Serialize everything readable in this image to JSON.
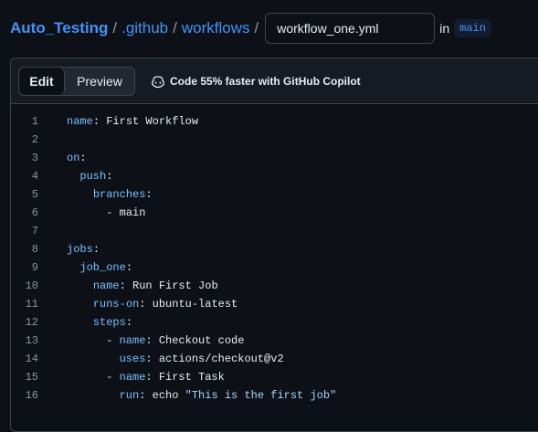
{
  "breadcrumb": {
    "repo": "Auto_Testing",
    "folder1": ".github",
    "folder2": "workflows",
    "separator": "/",
    "filename": "workflow_one.yml",
    "in_label": "in",
    "branch": "main"
  },
  "toolbar": {
    "edit_label": "Edit",
    "preview_label": "Preview",
    "copilot_text": "Code 55% faster with GitHub Copilot",
    "copilot_icon": "copilot-icon"
  },
  "code_lines": [
    {
      "n": "1",
      "indent": "",
      "key": "name",
      "rest": ": First Workflow"
    },
    {
      "n": "2",
      "indent": "",
      "key": "",
      "rest": ""
    },
    {
      "n": "3",
      "indent": "",
      "key": "on",
      "rest": ":"
    },
    {
      "n": "4",
      "indent": "  ",
      "key": "push",
      "rest": ":"
    },
    {
      "n": "5",
      "indent": "    ",
      "key": "branches",
      "rest": ":"
    },
    {
      "n": "6",
      "indent": "      ",
      "key": "",
      "rest": "- main"
    },
    {
      "n": "7",
      "indent": "",
      "key": "",
      "rest": ""
    },
    {
      "n": "8",
      "indent": "",
      "key": "jobs",
      "rest": ":"
    },
    {
      "n": "9",
      "indent": "  ",
      "key": "job_one",
      "rest": ":"
    },
    {
      "n": "10",
      "indent": "    ",
      "key": "name",
      "rest": ": Run First Job"
    },
    {
      "n": "11",
      "indent": "    ",
      "key": "runs-on",
      "rest": ": ubuntu-latest"
    },
    {
      "n": "12",
      "indent": "    ",
      "key": "steps",
      "rest": ":"
    },
    {
      "n": "13",
      "indent": "      - ",
      "key": "name",
      "rest": ": Checkout code"
    },
    {
      "n": "14",
      "indent": "        ",
      "key": "uses",
      "rest": ": actions/checkout@v2"
    },
    {
      "n": "15",
      "indent": "      - ",
      "key": "name",
      "rest": ": First Task"
    },
    {
      "n": "16",
      "indent": "        ",
      "key": "run",
      "rest": ": echo ",
      "str": "\"This is the first job\""
    }
  ],
  "colors": {
    "background": "#0d1117",
    "link": "#4493f8",
    "yaml_key": "#79c0ff",
    "yaml_string": "#a5d6ff"
  }
}
